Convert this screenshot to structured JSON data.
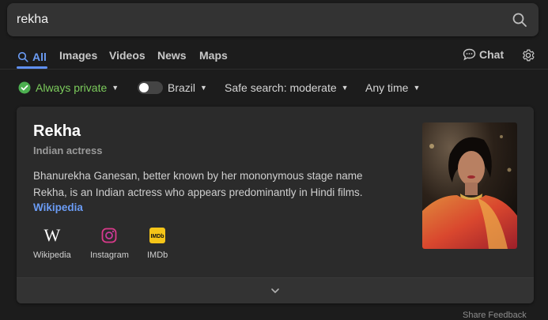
{
  "search": {
    "query": "rekha"
  },
  "tabs": [
    "All",
    "Images",
    "Videos",
    "News",
    "Maps"
  ],
  "chat_label": "Chat",
  "filters": {
    "privacy": "Always private",
    "region": "Brazil",
    "safe_search": "Safe search: moderate",
    "time": "Any time"
  },
  "card": {
    "title": "Rekha",
    "subtitle": "Indian actress",
    "description": "Bhanurekha Ganesan, better known by her mononymous stage name Rekha, is an Indian actress who appears predominantly in Hindi films.",
    "source_link": "Wikipedia",
    "profiles": [
      {
        "label": "Wikipedia",
        "icon": "wikipedia-icon"
      },
      {
        "label": "Instagram",
        "icon": "instagram-icon"
      },
      {
        "label": "IMDb",
        "icon": "imdb-icon"
      }
    ]
  },
  "feedback": "Share Feedback",
  "colors": {
    "accent": "#6b9cf5",
    "private_green": "#7ccc5c"
  }
}
